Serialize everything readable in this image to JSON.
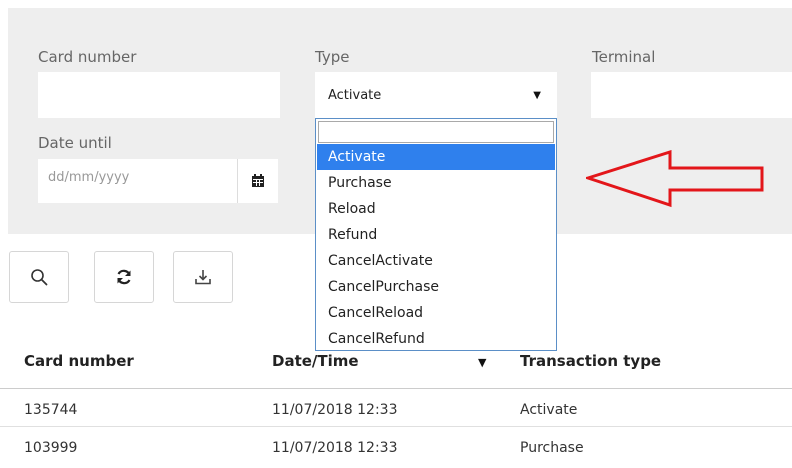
{
  "filters": {
    "card_number_label": "Card number",
    "card_number_value": "",
    "type_label": "Type",
    "type_value": "Activate",
    "terminal_label": "Terminal",
    "terminal_value": "",
    "date_until_label": "Date until",
    "date_until_placeholder": "dd/mm/yyyy"
  },
  "type_dropdown": {
    "search_value": "",
    "options": [
      "Activate",
      "Purchase",
      "Reload",
      "Refund",
      "CancelActivate",
      "CancelPurchase",
      "CancelReload",
      "CancelRefund"
    ],
    "selected": "Activate"
  },
  "toolbar": {
    "icons": [
      "search-icon",
      "refresh-icon",
      "download-icon"
    ]
  },
  "table": {
    "columns": [
      "Card number",
      "Date/Time",
      "Transaction type"
    ],
    "sort_column": "Date/Time",
    "rows": [
      [
        "135744",
        "11/07/2018 12:33",
        "Activate"
      ],
      [
        "103999",
        "11/07/2018 12:33",
        "Purchase"
      ]
    ]
  },
  "colors": {
    "panel_bg": "#eeeeee",
    "selected_option": "#2f80ed",
    "annotation_arrow": "#e3161a"
  }
}
